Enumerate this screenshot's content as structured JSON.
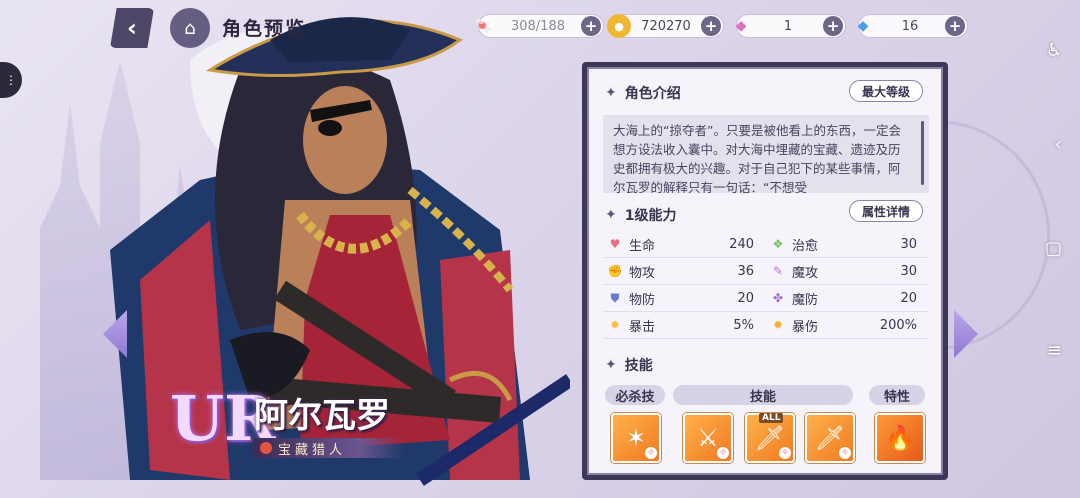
{
  "header": {
    "title": "角色预览",
    "resources": [
      {
        "name": "stamina",
        "icon": "candy-icon",
        "value": "308/188"
      },
      {
        "name": "gold",
        "icon": "coin-icon",
        "value": "720270"
      },
      {
        "name": "pink_gem",
        "icon": "pink-diamond-icon",
        "value": "1"
      },
      {
        "name": "blue_gem",
        "icon": "blue-diamond-icon",
        "value": "16"
      }
    ]
  },
  "character": {
    "rarity": "UR",
    "name": "阿尔瓦罗",
    "title": "宝藏猎人"
  },
  "panel": {
    "intro_heading": "角色介绍",
    "max_level_btn": "最大等级",
    "description": "大海上的“掠夺者”。只要是被他看上的东西，一定会想方设法收入囊中。对大海中埋藏的宝藏、遗迹及历史都拥有极大的兴趣。对于自己犯下的某些事情，阿尔瓦罗的解释只有一句话：“不想受",
    "ability_heading": "1级能力",
    "attr_detail_btn": "属性详情",
    "stats": [
      {
        "left": {
          "label": "生命",
          "value": "240",
          "icon": "heart-icon",
          "color": "#f06a7e"
        },
        "right": {
          "label": "治愈",
          "value": "30",
          "icon": "heal-icon",
          "color": "#6cc25a"
        }
      },
      {
        "left": {
          "label": "物攻",
          "value": "36",
          "icon": "fist-icon",
          "color": "#f0a040"
        },
        "right": {
          "label": "魔攻",
          "value": "30",
          "icon": "wand-icon",
          "color": "#c070e0"
        }
      },
      {
        "left": {
          "label": "物防",
          "value": "20",
          "icon": "shield-icon",
          "color": "#6a7ad0"
        },
        "right": {
          "label": "魔防",
          "value": "20",
          "icon": "magic-shield-icon",
          "color": "#a070d0"
        }
      },
      {
        "left": {
          "label": "暴击",
          "value": "5%",
          "icon": "crit-icon",
          "color": "#f5c040"
        },
        "right": {
          "label": "暴伤",
          "value": "200%",
          "icon": "crit-dmg-icon",
          "color": "#f5b030"
        }
      }
    ],
    "skills_heading": "技能",
    "skill_tabs": [
      "必杀技",
      "技能",
      "特性"
    ],
    "skill_all_tag": "ALL"
  }
}
